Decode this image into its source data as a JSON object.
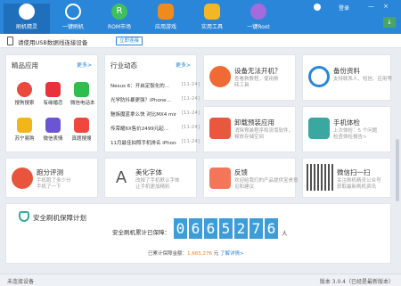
{
  "window": {
    "minimize": "—",
    "close": "×",
    "download_label": "↓"
  },
  "nav": {
    "items": [
      {
        "label": "刷机精灵",
        "icon": "shield-logo-icon",
        "color": "#ffffff"
      },
      {
        "label": "一键刷机",
        "icon": "flash-icon",
        "color": "#ffffff"
      },
      {
        "label": "ROM市场",
        "icon": "rom-market-icon",
        "color": "#3fbf5d"
      },
      {
        "label": "应用游戏",
        "icon": "apps-games-icon",
        "color": "#f08a1d"
      },
      {
        "label": "实用工具",
        "icon": "tools-icon",
        "color": "#f5b623"
      },
      {
        "label": "一键Root",
        "icon": "root-icon",
        "color": "#a36bdc"
      }
    ],
    "login": "登录"
  },
  "device_bar": {
    "text": "请使用USB数据线连接设备",
    "button": "立即连接"
  },
  "apps_panel": {
    "title": "精品应用",
    "more": "更多>",
    "apps": [
      {
        "label": "搜狗搜索",
        "color": "#e94a3c"
      },
      {
        "label": "有缘婚恋",
        "color": "#e8313a"
      },
      {
        "label": "微信电话本",
        "color": "#2fbd4e"
      },
      {
        "label": "苏宁易购",
        "color": "#f2b619"
      },
      {
        "label": "微信表情",
        "color": "#6b55d4"
      },
      {
        "label": "真题搜搜",
        "color": "#f0463b"
      }
    ]
  },
  "news_panel": {
    "title": "行业动态",
    "more": "更多>",
    "items": [
      {
        "title": "Nexus 6：开启定製化的...",
        "date": "[11-24]"
      },
      {
        "title": "光学防抖暴更强？iPhone...",
        "date": "[11-24]"
      },
      {
        "title": "魅族魔蓝拿么快 对比MX4 mini...",
        "date": "[11-24]"
      },
      {
        "title": "传荣耀6X售价2499元起...",
        "date": "[11-24]"
      },
      {
        "title": "11月最佳拍照手机排名 iPhone...",
        "date": "[11-24]"
      }
    ]
  },
  "features": [
    {
      "title": "设备无法开机？",
      "desc": [
        "查看救教程，使用救",
        "砖工具"
      ],
      "color": "#f06a35",
      "icon": "power-icon"
    },
    {
      "title": "备份资料",
      "desc": [
        "支持联系人、短信、应用等"
      ],
      "color": "#2a86d8",
      "icon": "backup-icon"
    },
    {
      "title": "卸载预装应用",
      "desc": [
        "消除预装程序和流氓软件，",
        "释放存储空间"
      ],
      "color": "#e8573e",
      "icon": "trash-icon"
    },
    {
      "title": "手机体检",
      "desc": [
        "上次体检：5 个问题",
        "检查体检报告>"
      ],
      "color": "#3aa7a0",
      "icon": "phone-check-icon"
    },
    {
      "title": "跑分评测",
      "desc": [
        "手机跑了多少分",
        "手机了一下"
      ],
      "color": "#e8553c",
      "icon": "benchmark-icon"
    },
    {
      "title": "美化字体",
      "desc": [
        "改掉了手机默认字体",
        "让手机更加精彩"
      ],
      "color": "#555555",
      "icon": "font-icon"
    },
    {
      "title": "反馈",
      "desc": [
        "欢迎给我们的产品提供宝贵意",
        "见和建议"
      ],
      "color": "#f3765a",
      "icon": "feedback-icon"
    },
    {
      "title": "微信扫一扫",
      "desc": [
        "关注刷机精灵公众号",
        "获取最新刷机资讯"
      ],
      "color": "#333333",
      "icon": "qr-code-icon"
    }
  ],
  "plan": {
    "title": "安全刷机保障计划",
    "count_label": "安全刷机累计已保障：",
    "digits": [
      "0",
      "6",
      "6",
      "5",
      "2",
      "7",
      "6"
    ],
    "unit": "人",
    "saved_prefix": "已累计保障金额：",
    "saved_amount": "1,665,276",
    "saved_suffix": " 元",
    "saved_link": "了解详情>"
  },
  "status": {
    "left": "未连接设备",
    "right": "版本 3.0.4（已经是最新版本）"
  }
}
